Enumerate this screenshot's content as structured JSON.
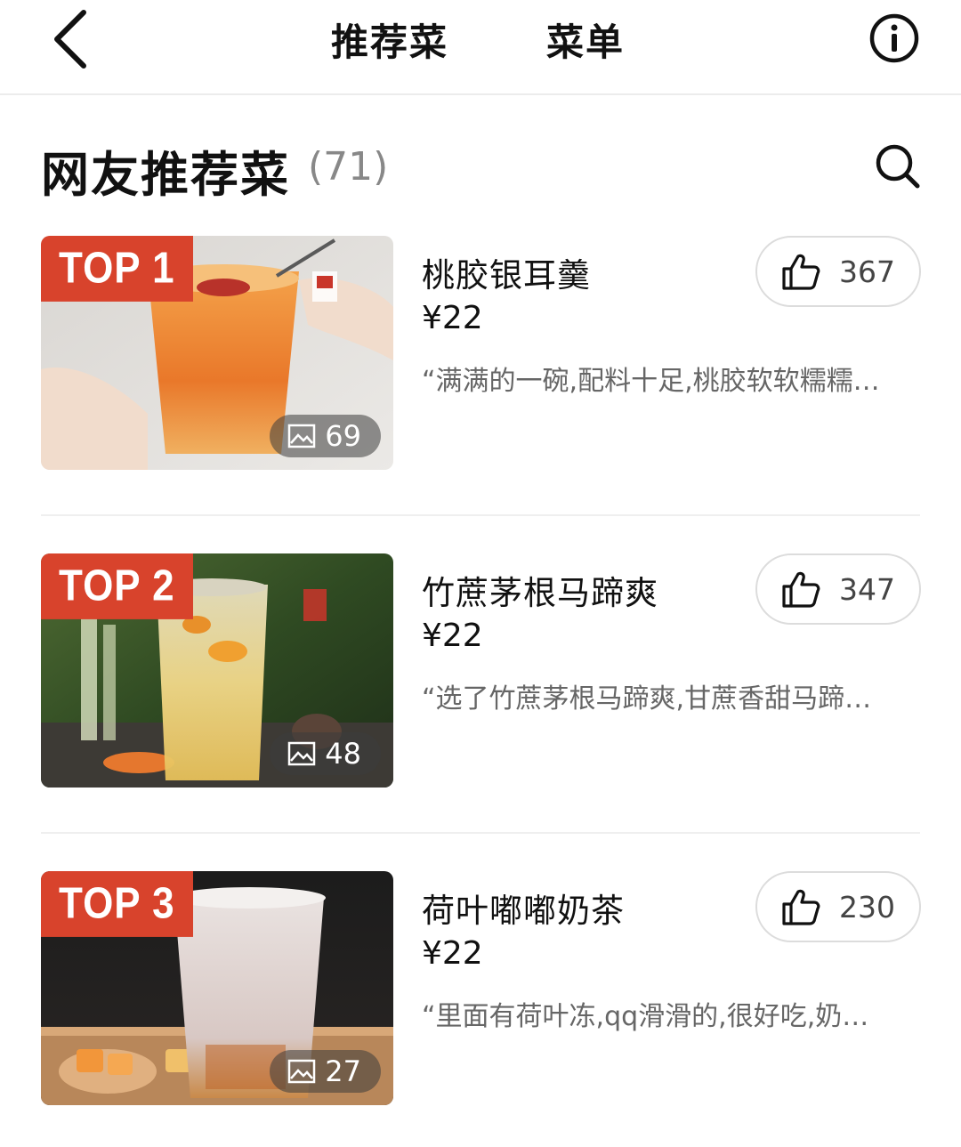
{
  "nav": {
    "tab_recommended": "推荐菜",
    "tab_menu": "菜单"
  },
  "section": {
    "title": "网友推荐菜",
    "count": "(71)"
  },
  "colors": {
    "accent": "#d8432c",
    "tab_underline": "#f4502a"
  },
  "dishes": [
    {
      "rank_label": "TOP 1",
      "name": "桃胶银耳羹",
      "price": "¥22",
      "quote": "“满满的一碗,配料十足,桃胶软软糯糯…",
      "likes": "367",
      "photos": "69"
    },
    {
      "rank_label": "TOP 2",
      "name": "竹蔗茅根马蹄爽",
      "price": "¥22",
      "quote": "“选了竹蔗茅根马蹄爽,甘蔗香甜马蹄…",
      "likes": "347",
      "photos": "48"
    },
    {
      "rank_label": "TOP 3",
      "name": "荷叶嘟嘟奶茶",
      "price": "¥22",
      "quote": "“里面有荷叶冻,qq滑滑的,很好吃,奶…",
      "likes": "230",
      "photos": "27"
    }
  ],
  "icons": {
    "back": "chevron-left-icon",
    "info": "info-icon",
    "search": "search-icon",
    "like": "thumbs-up-icon",
    "photo": "image-icon"
  }
}
